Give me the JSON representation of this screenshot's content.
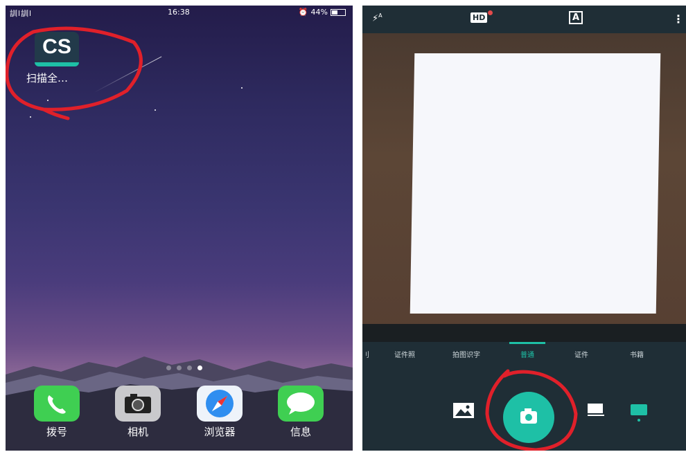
{
  "left_screen": {
    "status_bar": {
      "signal": "訓l訓l",
      "time": "16:38",
      "battery": "44%"
    },
    "app": {
      "icon_text": "CS",
      "label": "扫描全…"
    },
    "page_dots": 4,
    "dock": [
      {
        "label": "拨号",
        "icon": "phone-icon",
        "color": "#3fcf52"
      },
      {
        "label": "相机",
        "icon": "camera-icon",
        "color": "#c9c9cc"
      },
      {
        "label": "浏览器",
        "icon": "compass-icon",
        "color": "#2f8ef0"
      },
      {
        "label": "信息",
        "icon": "message-icon",
        "color": "#3fcf52"
      }
    ]
  },
  "right_screen": {
    "top_bar": {
      "flash": "auto",
      "hd_label": "HD",
      "text_mode": "A"
    },
    "modes": [
      "证件照",
      "拍图识字",
      "普通",
      "证件",
      "书籍"
    ],
    "active_mode": "普通",
    "accent": "#1ec0a6"
  },
  "annotation_color": "#e0202a"
}
